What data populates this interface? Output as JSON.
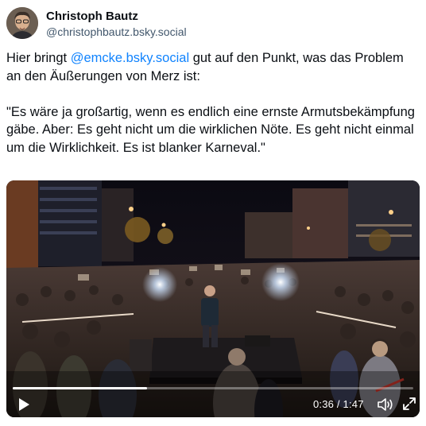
{
  "author": {
    "name": "Christoph Bautz",
    "handle": "@christophbautz.bsky.social"
  },
  "post": {
    "text_before_mention": "Hier bringt ",
    "mention": "@emcke.bsky.social",
    "text_after_mention": " gut auf den Punkt, was das Problem an den Äußerungen von Merz ist:\n\n\"Es wäre ja großartig, wenn es endlich eine ernste Armutsbekämpfung gäbe. Aber: Es geht nicht um die wirklichen Nöte. Es geht nicht einmal um die Wirklichkeit. Es ist blanker Karneval.\""
  },
  "video": {
    "time_display": "0:36 / 1:47",
    "progress_fraction": 0.336,
    "icons": {
      "play": "play-icon",
      "volume": "volume-icon",
      "fullscreen": "fullscreen-icon"
    }
  },
  "colors": {
    "mention": "#1083fe",
    "handle": "#42576c"
  }
}
